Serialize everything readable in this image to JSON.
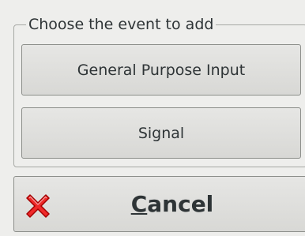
{
  "group": {
    "title": "Choose the event to add"
  },
  "buttons": {
    "gpi_label": "General Purpose Input",
    "signal_label": "Signal"
  },
  "cancel": {
    "mnemonic": "C",
    "rest": "ancel",
    "icon": "red-x-cancel-icon"
  },
  "colors": {
    "cancel_icon_red": "#ef2929",
    "cancel_icon_dark": "#a40000"
  }
}
